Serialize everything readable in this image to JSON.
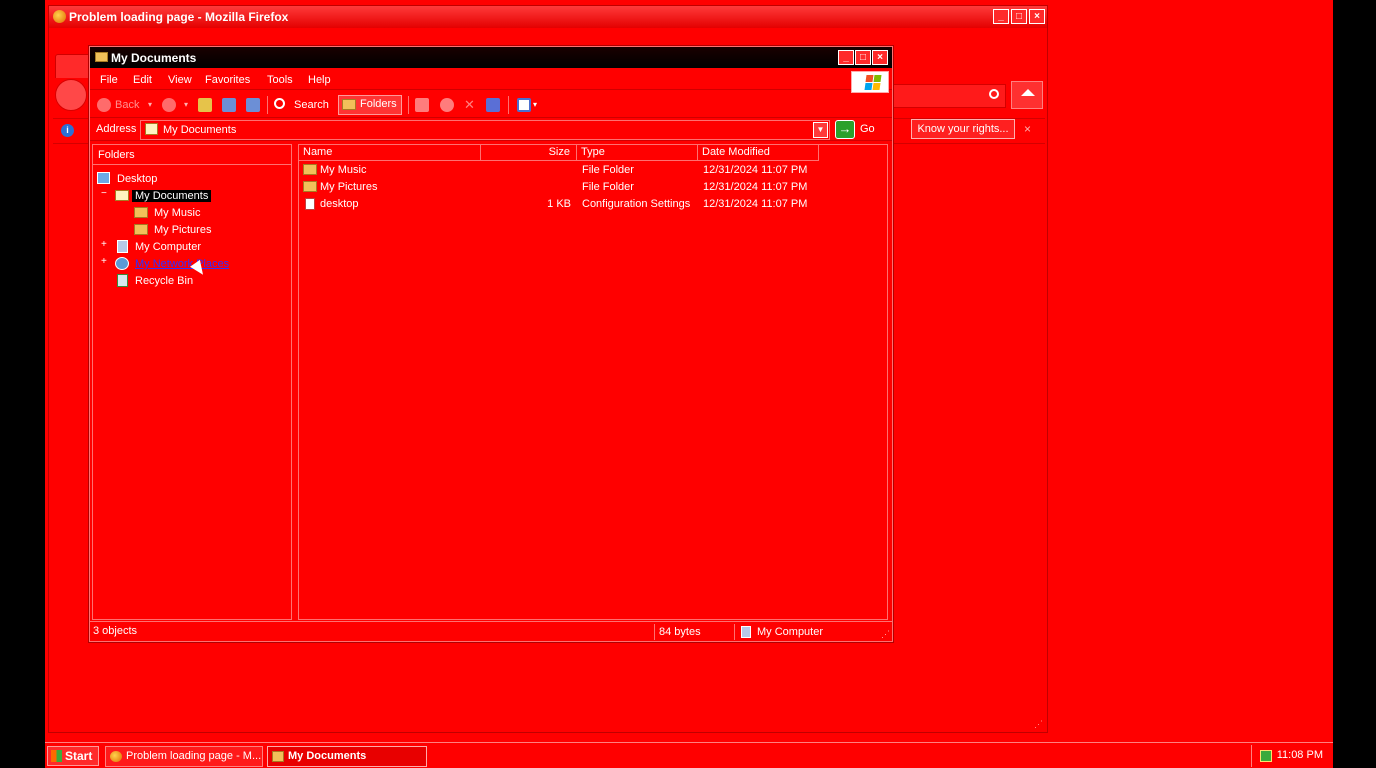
{
  "firefox": {
    "title": "Problem loading page - Mozilla Firefox",
    "infobar_button": "Know your rights...",
    "infobar_close": "×"
  },
  "explorer": {
    "title": "My Documents",
    "menu": [
      "File",
      "Edit",
      "View",
      "Favorites",
      "Tools",
      "Help"
    ],
    "toolbar": {
      "back": "Back",
      "search": "Search",
      "folders": "Folders"
    },
    "address": {
      "label": "Address",
      "value": "My Documents",
      "go": "Go"
    },
    "tree": {
      "header": "Folders",
      "nodes": [
        "Desktop",
        "My Documents",
        "My Music",
        "My Pictures",
        "My Computer",
        "My Network Places",
        "Recycle Bin"
      ]
    },
    "list": {
      "columns": [
        "Name",
        "Size",
        "Type",
        "Date Modified"
      ],
      "rows": [
        {
          "name": "My Music",
          "size": "",
          "type": "File Folder",
          "date": "12/31/2024 11:07 PM"
        },
        {
          "name": "My Pictures",
          "size": "",
          "type": "File Folder",
          "date": "12/31/2024 11:07 PM"
        },
        {
          "name": "desktop",
          "size": "1 KB",
          "type": "Configuration Settings",
          "date": "12/31/2024 11:07 PM"
        }
      ]
    },
    "status": {
      "objects": "3 objects",
      "size": "84 bytes",
      "location": "My Computer"
    }
  },
  "taskbar": {
    "start": "Start",
    "tasks": [
      "Problem loading page - M...",
      "My Documents"
    ],
    "clock": "11:08 PM"
  },
  "colors": {
    "background": "#ff0000",
    "selection": "#000000",
    "link": "#3030ff"
  }
}
